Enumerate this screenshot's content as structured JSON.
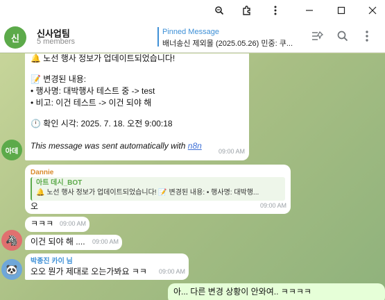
{
  "window": {
    "zoom_icon": "zoom-icon",
    "extension_icon": "puzzle-icon",
    "menu_icon": "kebab-icon",
    "minimize_icon": "minimize-icon",
    "maximize_icon": "maximize-icon",
    "close_icon": "close-icon"
  },
  "header": {
    "avatar_letter": "신",
    "group_name": "신사업팀",
    "members": "5 members",
    "pinned_label": "Pinned Message",
    "pinned_text": "배너송신 제외몰 (2025.05.26) 민중: 쿠...",
    "avatar_color": "#5caa4a"
  },
  "messages": {
    "bot_msg": {
      "line1": "🔔 노선 행사 정보가 업데이트되었습니다!",
      "line2": "📝 변경된 내용:",
      "line3": "• 행사명: 대박행사 테스트 중 -> test",
      "line4": "• 비고: 이건 테스트 -> 이건 되야 해",
      "line5": "🕛 확인 시각: 2025. 7. 18. 오전 9:00:18",
      "footer_text": "This message was sent automatically with",
      "footer_link": "n8n",
      "time": "09:00 AM",
      "avatar_text": "아데"
    },
    "dannie_msg": {
      "sender": "Dannie",
      "quote_sender": "아트 데시_BOT",
      "quote_text": "🔔 노선 행사 정보가 업데이트되었습니다! 📝 변경된 내용: • 행사명: 대박행...",
      "text": "오",
      "time": "09:00 AM"
    },
    "msg3": {
      "text": "ㅋㅋㅋ",
      "time": "09:00 AM"
    },
    "msg4": {
      "text": "이건 되야 해 ....",
      "time": "09:00 AM"
    },
    "msg5": {
      "sender": "박종진 카이 님",
      "text": "오오 뭔가 제대로 오는가봐요 ㅋㅋ",
      "time": "09:00 AM"
    },
    "msg6": {
      "text": "아... 다른 변경 상황이 안와여..  ㅋㅋㅋㅋ"
    }
  }
}
